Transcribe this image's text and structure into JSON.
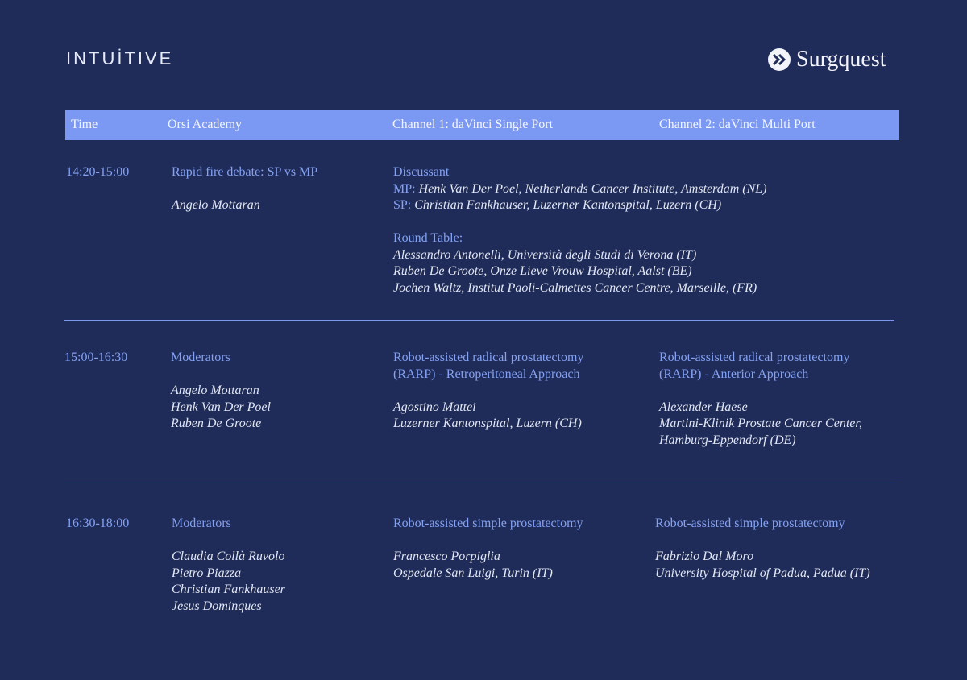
{
  "logos": {
    "left": "INTUİTIVE",
    "right": "Surgquest"
  },
  "header": {
    "time": "Time",
    "academy": "Orsi Academy",
    "channel1": "Channel 1: daVinci Single Port",
    "channel2": "Channel 2: daVinci Multi Port"
  },
  "rows": [
    {
      "time": "14:20-15:00",
      "academy_title": "Rapid fire debate: SP vs MP",
      "academy_person": "Angelo Mottaran",
      "discussant_label": "Discussant",
      "mp_label": "MP:",
      "mp_text": "Henk Van Der Poel, Netherlands Cancer Institute, Amsterdam (NL)",
      "sp_label": "SP:",
      "sp_text": "Christian Fankhauser, Luzerner Kantonspital, Luzern (CH)",
      "round_table_label": "Round Table:",
      "round_table": [
        "Alessandro Antonelli, Università degli Studi di Verona (IT)",
        "Ruben De Groote, Onze Lieve Vrouw Hospital, Aalst (BE)",
        "Jochen Waltz, Institut Paoli-Calmettes Cancer Centre, Marseille, (FR)"
      ]
    },
    {
      "time": "15:00-16:30",
      "academy_title": "Moderators",
      "moderators": [
        "Angelo Mottaran",
        "Henk Van Der Poel",
        "Ruben De Groote"
      ],
      "ch1_title": [
        "Robot-assisted radical prostatectomy",
        "(RARP) - Retroperitoneal Approach"
      ],
      "ch1_people": [
        "Agostino Mattei",
        "Luzerner Kantonspital, Luzern (CH)"
      ],
      "ch2_title": [
        "Robot-assisted radical prostatectomy",
        "(RARP) - Anterior Approach"
      ],
      "ch2_people": [
        "Alexander Haese",
        "Martini-Klinik Prostate Cancer Center,",
        "Hamburg-Eppendorf (DE)"
      ]
    },
    {
      "time": "16:30-18:00",
      "academy_title": "Moderators",
      "moderators": [
        "Claudia Collà Ruvolo",
        "Pietro Piazza",
        "Christian Fankhauser",
        "Jesus Dominques"
      ],
      "ch1_title": "Robot-assisted simple prostatectomy",
      "ch1_people": [
        "Francesco Porpiglia",
        "Ospedale San Luigi, Turin (IT)"
      ],
      "ch2_title": "Robot-assisted simple prostatectomy",
      "ch2_people": [
        "Fabrizio Dal Moro",
        "University Hospital of Padua, Padua (IT)"
      ]
    }
  ]
}
